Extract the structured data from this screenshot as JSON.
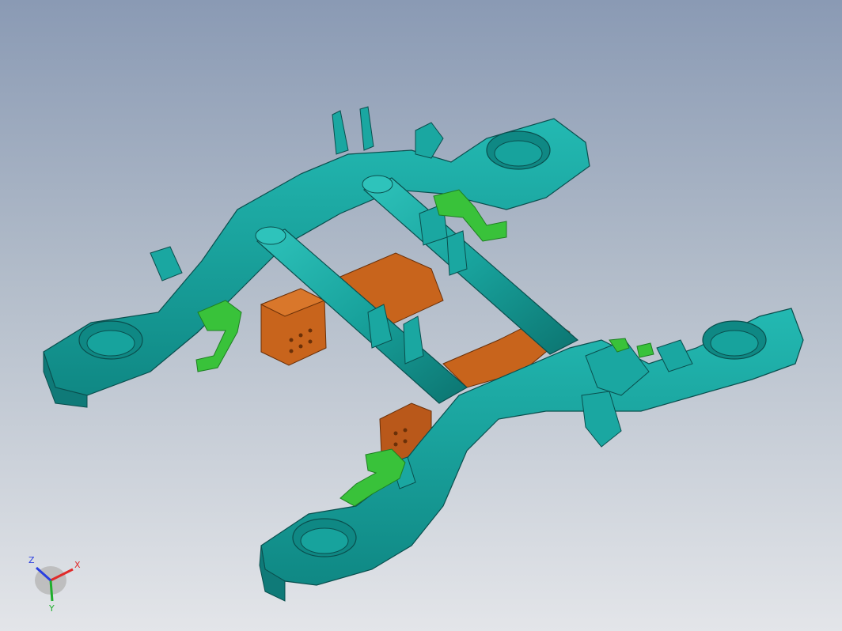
{
  "viewport": {
    "background_top": "#8a9ab4",
    "background_bottom": "#e3e5e9"
  },
  "model": {
    "colors": {
      "frame": "#1aa7a1",
      "frame_dark": "#0f7a78",
      "frame_edge": "#0a4f4e",
      "bolster": "#c8641c",
      "bolster_dark": "#8f4512",
      "bracket": "#39c23a",
      "bracket_dark": "#1e7f22"
    }
  },
  "triad": {
    "x_label": "X",
    "y_label": "Y",
    "z_label": "Z",
    "x_color": "#e02a2a",
    "y_color": "#1fae2c",
    "z_color": "#2a3fe0"
  }
}
